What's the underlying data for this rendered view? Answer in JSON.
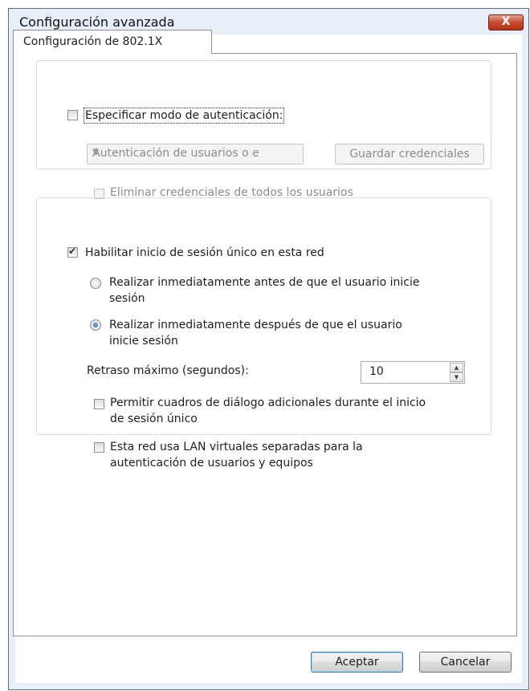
{
  "window": {
    "title": "Configuración avanzada",
    "close_symbol": "X"
  },
  "tab": {
    "label": "Configuración de 802.1X"
  },
  "auth_group": {
    "specify_mode_label": "Especificar modo de autenticación:",
    "specify_mode_checked": false,
    "mode_select_value": "Autenticación de usuarios o e",
    "save_credentials_label": "Guardar credenciales",
    "delete_credentials_label": "Eliminar credenciales de todos los usuarios",
    "delete_credentials_checked": false
  },
  "sso_group": {
    "enable_label": "Habilitar inicio de sesión único en esta red",
    "enable_checked": true,
    "radio_before_line1": "Realizar inmediatamente antes de que el usuario inicie",
    "radio_before_line2": "sesión",
    "radio_after_line1": "Realizar inmediatamente después de que el usuario",
    "radio_after_line2": "inicie sesión",
    "selected_radio": "after",
    "max_delay_label": "Retraso máximo (segundos):",
    "max_delay_value": "10",
    "allow_dialogs_line1": "Permitir cuadros de diálogo adicionales durante el inicio",
    "allow_dialogs_line2": "de sesión único",
    "allow_dialogs_checked": false,
    "vlan_line1": "Esta red usa LAN virtuales separadas para la",
    "vlan_line2": "autenticación de usuarios y equipos",
    "vlan_checked": false
  },
  "footer": {
    "ok_label": "Aceptar",
    "cancel_label": "Cancelar"
  },
  "icons": {
    "close": "close-icon",
    "spin_up": "spin-up-arrow-icon",
    "spin_down": "spin-down-arrow-icon",
    "dropdown": "chevron-down-icon"
  }
}
